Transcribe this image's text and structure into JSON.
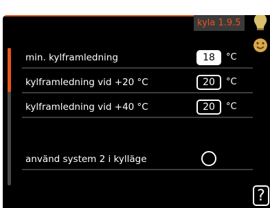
{
  "header": {
    "menu_code": "kyla 1.9.5"
  },
  "icons": {
    "bulb": "lightbulb-icon",
    "smile": "smiley-icon",
    "help": "help-icon"
  },
  "colors": {
    "accent": "#e8561b",
    "background": "#000000",
    "text": "#ffffff",
    "bulb": "#d9c06a"
  },
  "rows": [
    {
      "label": "min. kylframledning",
      "value": "18",
      "unit": "°C",
      "selected": true
    },
    {
      "label": "kylframledning vid +20 °C",
      "value": "20",
      "unit": "°C",
      "selected": false
    },
    {
      "label": "kylframledning vid +40 °C",
      "value": "20",
      "unit": "°C",
      "selected": false
    }
  ],
  "option": {
    "label": "använd system 2 i kylläge",
    "checked": false
  },
  "help": {
    "symbol": "?"
  }
}
